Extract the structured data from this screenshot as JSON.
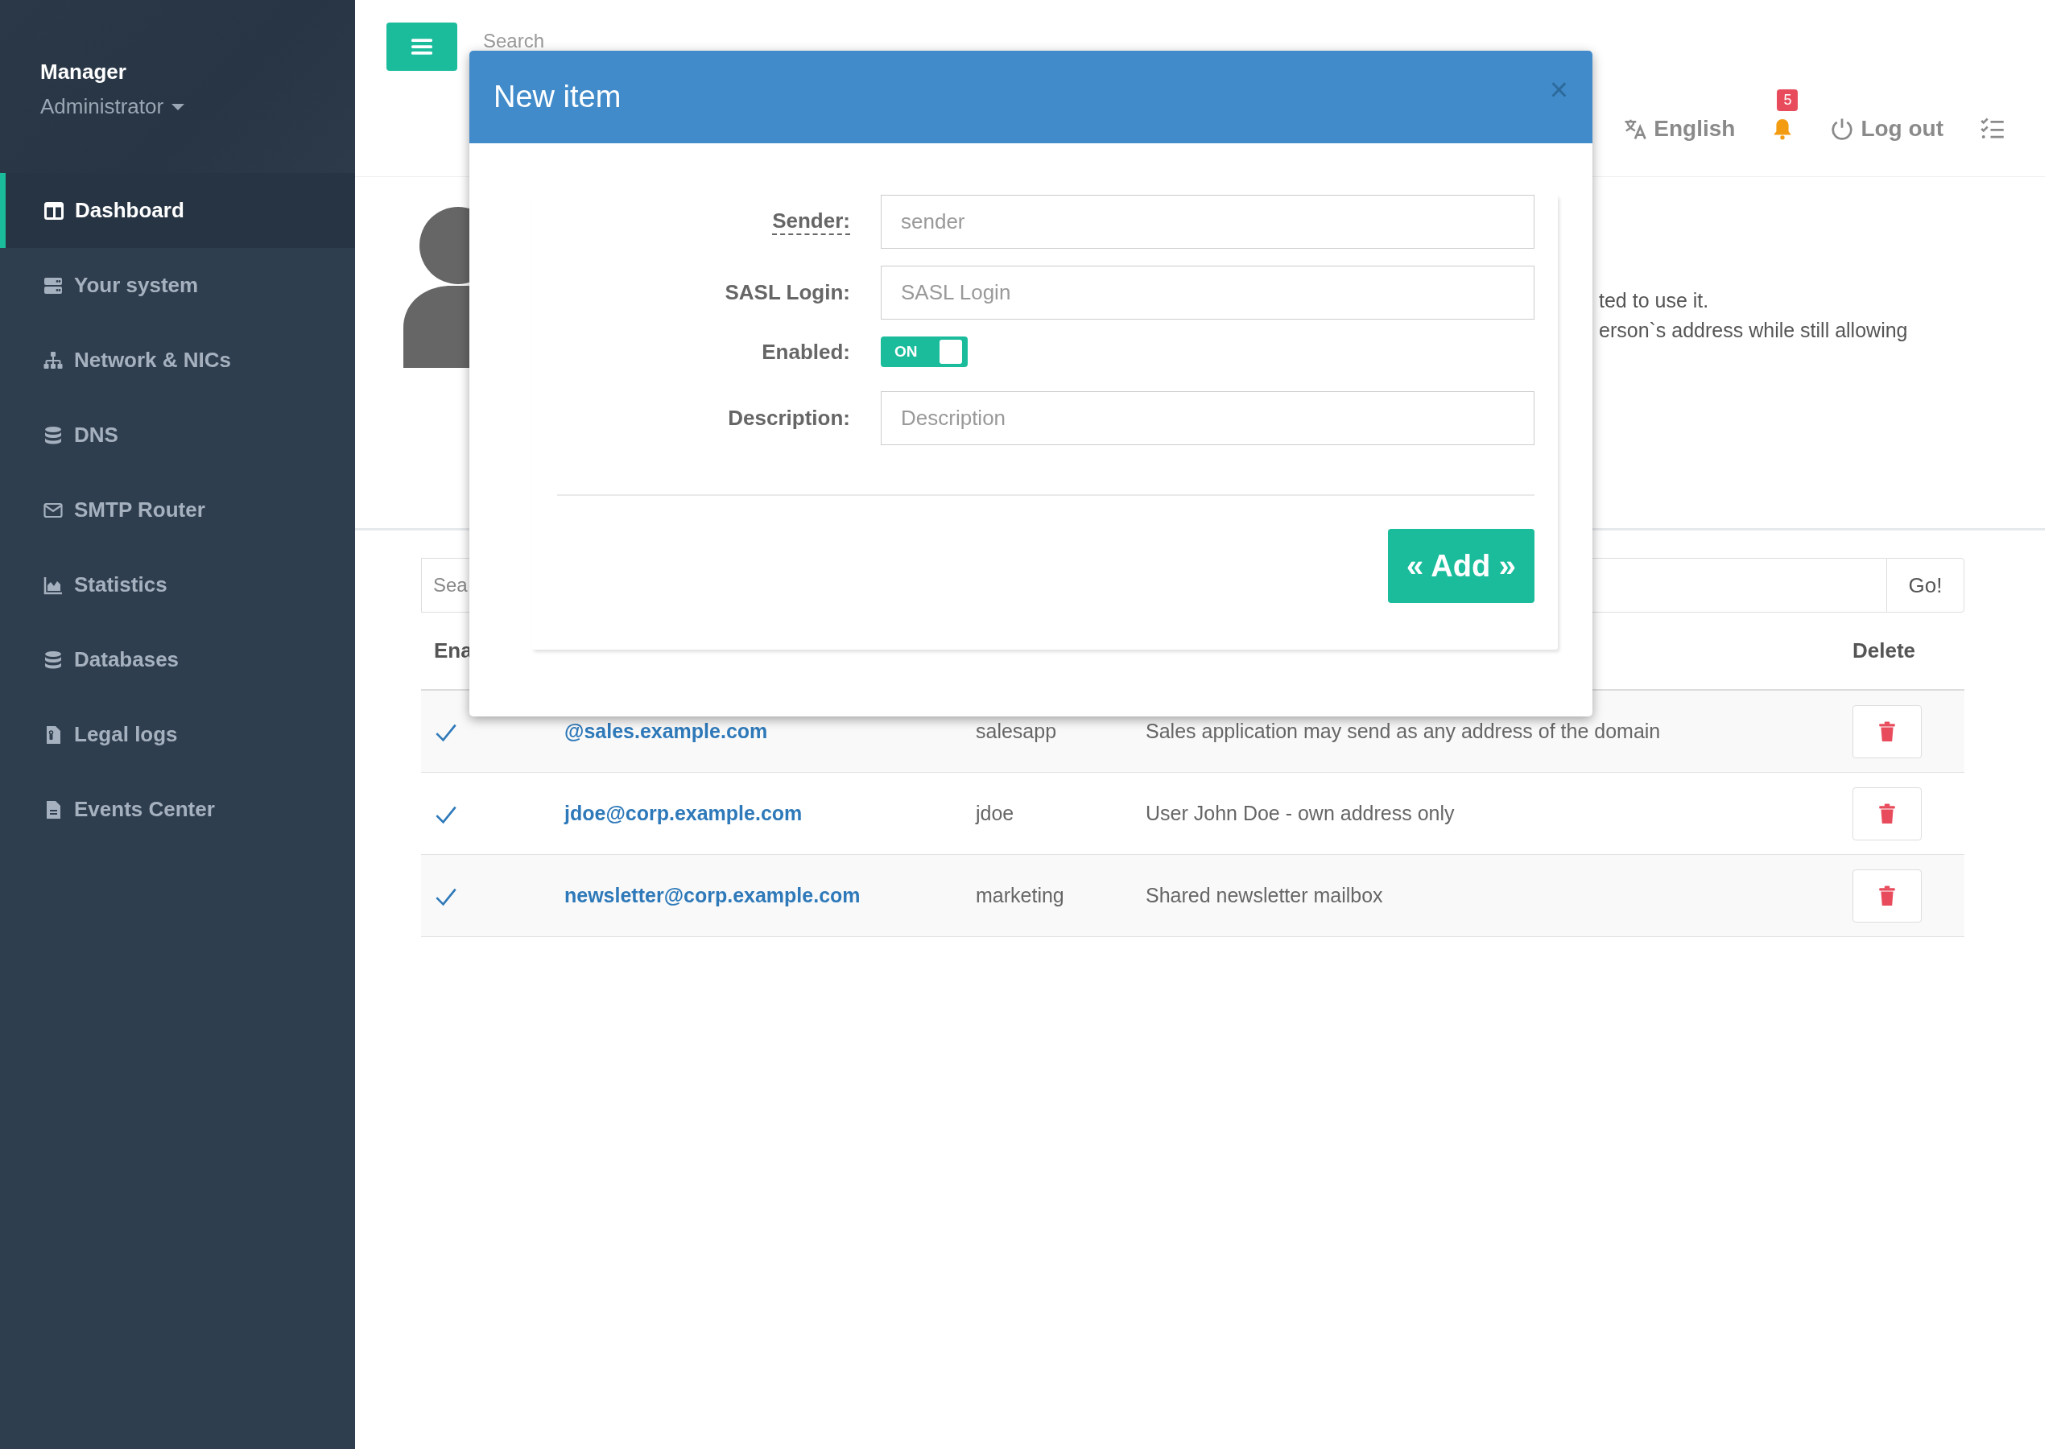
{
  "sidebar": {
    "user": {
      "name": "Manager",
      "role": "Administrator"
    },
    "items": [
      {
        "label": "Dashboard",
        "selected": true
      },
      {
        "label": "Your system",
        "selected": false
      },
      {
        "label": "Network & NICs",
        "selected": false
      },
      {
        "label": "DNS",
        "selected": false
      },
      {
        "label": "SMTP Router",
        "selected": false
      },
      {
        "label": "Statistics",
        "selected": false
      },
      {
        "label": "Databases",
        "selected": false
      },
      {
        "label": "Legal logs",
        "selected": false
      },
      {
        "label": "Events Center",
        "selected": false
      }
    ]
  },
  "topbar": {
    "search_placeholder": "Search",
    "language": "English",
    "notifications": "5",
    "logout": "Log out"
  },
  "intro": {
    "lines": [
      "ted to use it.",
      "erson`s address while still allowing"
    ]
  },
  "filter": {
    "placeholder": "Sea",
    "button": "Go!"
  },
  "table": {
    "columns": [
      "Ena",
      "Delete"
    ],
    "rows": [
      {
        "enabled": true,
        "sender": "@sales.example.com",
        "login": "salesapp",
        "description": "Sales application may send as any address of the domain"
      },
      {
        "enabled": true,
        "sender": "jdoe@corp.example.com",
        "login": "jdoe",
        "description": "User John Doe - own address only"
      },
      {
        "enabled": true,
        "sender": "newsletter@corp.example.com",
        "login": "marketing",
        "description": "Shared newsletter mailbox"
      }
    ]
  },
  "modal": {
    "title": "New item",
    "close": "×",
    "fields": [
      {
        "kind": "text",
        "label": "Sender:",
        "placeholder": "sender",
        "has_tooltip": true
      },
      {
        "kind": "text",
        "label": "SASL Login:",
        "placeholder": "SASL Login",
        "has_tooltip": false
      },
      {
        "kind": "toggle",
        "label": "Enabled:",
        "on": true,
        "on_label": "ON",
        "has_tooltip": false
      },
      {
        "kind": "text",
        "label": "Description:",
        "placeholder": "Description",
        "has_tooltip": false
      }
    ],
    "submit": "« Add »"
  }
}
